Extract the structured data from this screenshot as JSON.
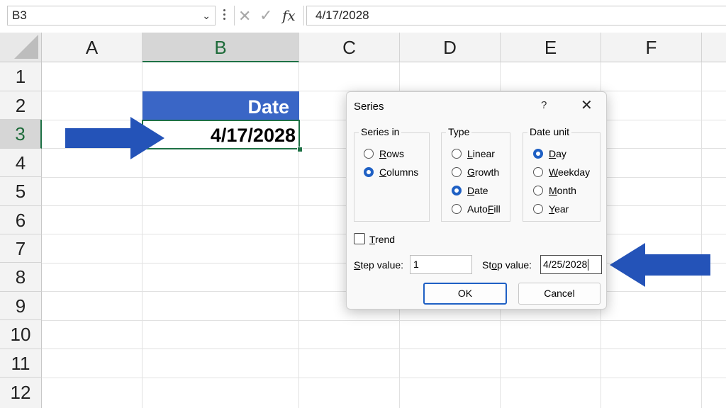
{
  "formula_bar": {
    "name_box": "B3",
    "content": "4/17/2028",
    "icons": [
      "chevron-down-icon",
      "more-icon",
      "cancel-icon",
      "enter-icon",
      "function-icon"
    ]
  },
  "grid": {
    "columns": [
      "A",
      "B",
      "C",
      "D",
      "E",
      "F"
    ],
    "rows": [
      "1",
      "2",
      "3",
      "4",
      "5",
      "6",
      "7",
      "8",
      "9",
      "10",
      "11",
      "12"
    ],
    "selected_column": "B",
    "selected_row": "3",
    "header_cell": "Date",
    "date_cell": "4/17/2028",
    "header_fill": "#3a66c6",
    "selection_color": "#1e7145"
  },
  "annotations": {
    "arrow_color": "#2453b8"
  },
  "dialog": {
    "title": "Series",
    "help": "?",
    "close": "✕",
    "series_in": {
      "label": "Series in",
      "options": [
        {
          "pre": "",
          "key": "R",
          "post": "ows",
          "selected": false
        },
        {
          "pre": "",
          "key": "C",
          "post": "olumns",
          "selected": true
        }
      ]
    },
    "type": {
      "label": "Type",
      "options": [
        {
          "pre": "",
          "key": "L",
          "post": "inear",
          "selected": false
        },
        {
          "pre": "",
          "key": "G",
          "post": "rowth",
          "selected": false
        },
        {
          "pre": "",
          "key": "D",
          "post": "ate",
          "selected": true
        },
        {
          "pre": "Auto",
          "key": "F",
          "post": "ill",
          "selected": false
        }
      ]
    },
    "date_unit": {
      "label": "Date unit",
      "options": [
        {
          "pre": "",
          "key": "D",
          "post": "ay",
          "selected": true
        },
        {
          "pre": "",
          "key": "W",
          "post": "eekday",
          "selected": false
        },
        {
          "pre": "",
          "key": "M",
          "post": "onth",
          "selected": false
        },
        {
          "pre": "",
          "key": "Y",
          "post": "ear",
          "selected": false
        }
      ]
    },
    "trend": {
      "key": "T",
      "post": "rend",
      "checked": false
    },
    "step": {
      "key": "S",
      "post": "tep value:",
      "value": "1"
    },
    "stop": {
      "pre": "St",
      "key": "o",
      "post": "p value:",
      "value": "4/25/2028"
    },
    "ok_label": "OK",
    "cancel_label": "Cancel"
  }
}
